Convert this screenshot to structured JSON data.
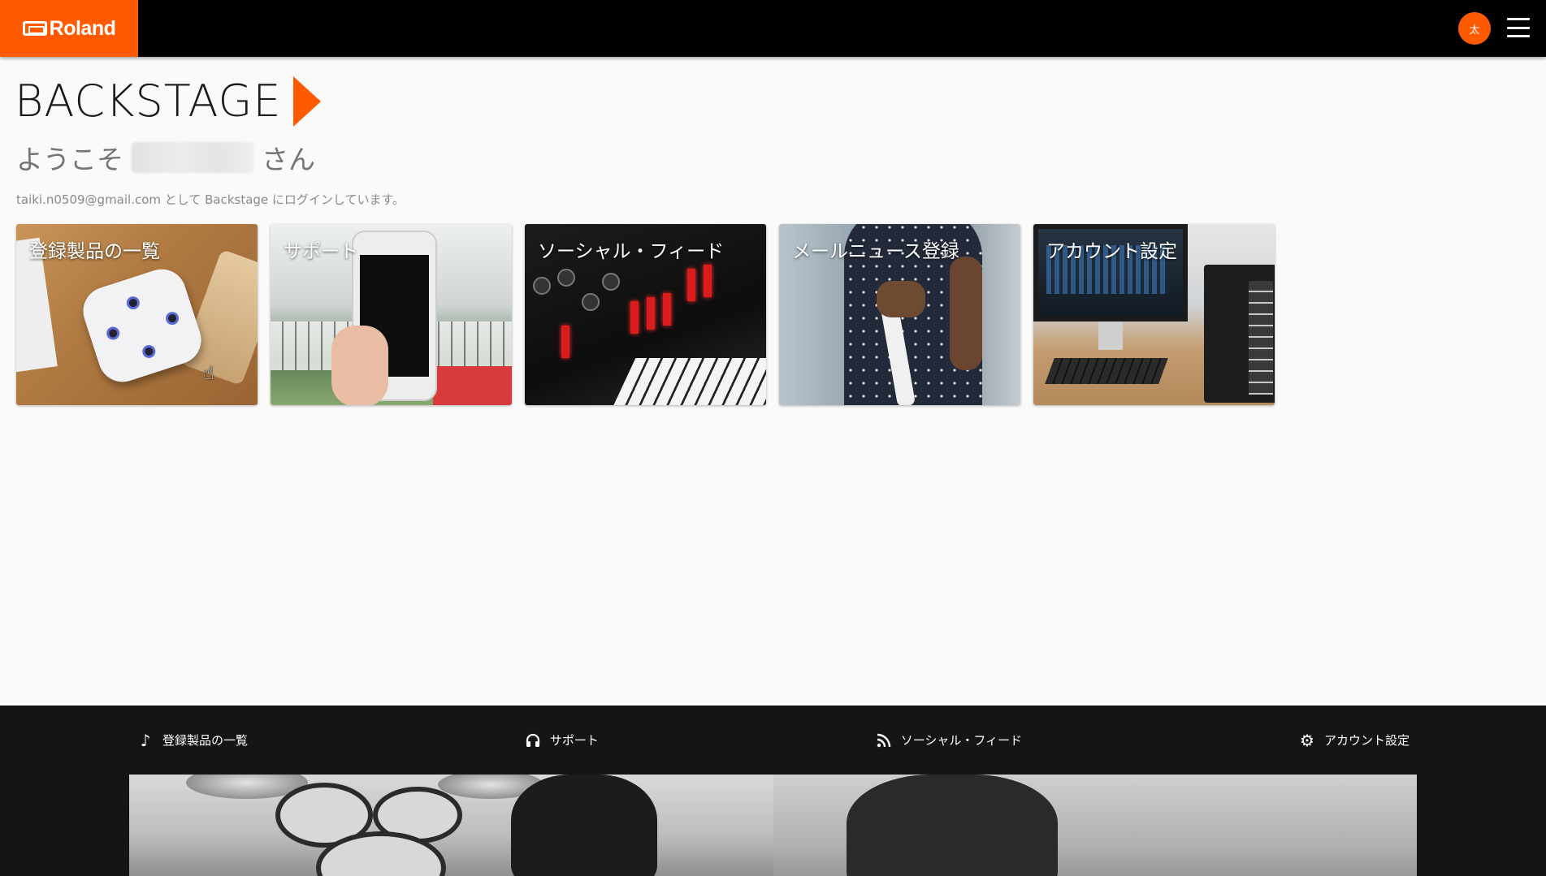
{
  "header": {
    "logo_text": "Roland",
    "avatar_initial": "太",
    "menu_icon": "hamburger-menu-icon"
  },
  "brand": {
    "title": "BACKSTAGE",
    "arrow_icon": "play-arrow-icon",
    "accent_color": "#ff5a00"
  },
  "welcome": {
    "prefix": "ようこそ",
    "suffix": "さん",
    "login_note": "taiki.n0509@gmail.com として Backstage にログインしています。"
  },
  "tiles": [
    {
      "label": "登録製品の一覧"
    },
    {
      "label": "サポート"
    },
    {
      "label": "ソーシャル・フィード"
    },
    {
      "label": "メールニュース登録"
    },
    {
      "label": "アカウント設定"
    }
  ],
  "footer": {
    "nav": [
      {
        "label": "登録製品の一覧",
        "icon": "music-note-icon"
      },
      {
        "label": "サポート",
        "icon": "headphones-icon"
      },
      {
        "label": "ソーシャル・フィード",
        "icon": "rss-feed-icon"
      },
      {
        "label": "アカウント設定",
        "icon": "gear-icon"
      }
    ]
  }
}
